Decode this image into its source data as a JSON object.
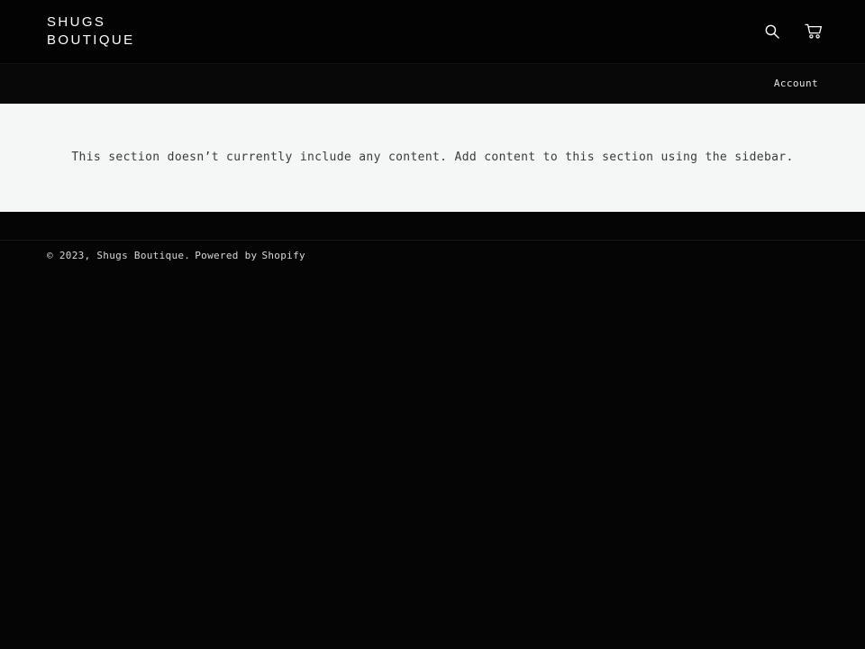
{
  "site": {
    "title": "Shugs Boutique",
    "background_color": "#000000",
    "content_background_color": "#f5f6f6"
  },
  "header": {
    "logo": "SHUGS BOUTIQUE",
    "icons": [
      {
        "name": "search-icon",
        "label": "Search"
      },
      {
        "name": "cart-icon",
        "label": "Cart"
      }
    ]
  },
  "nav": {
    "account_label": "Account"
  },
  "main": {
    "placeholder_message": "This section doesn’t currently include any content. Add content to this section using the sidebar."
  },
  "footer": {
    "copyright": "© 2023, Shugs Boutique.",
    "powered_by_prefix": "Powered by",
    "powered_by_link": "Shopify"
  }
}
